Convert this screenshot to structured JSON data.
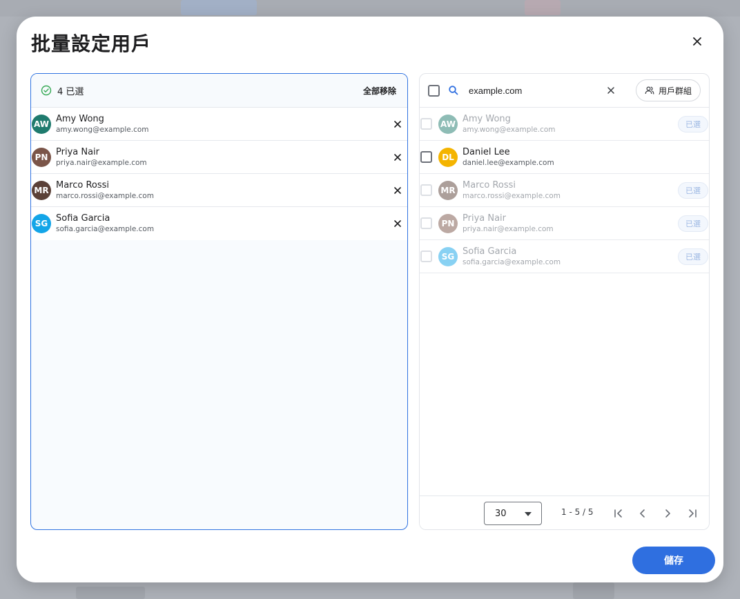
{
  "dialog": {
    "title": "批量設定用戶",
    "save_label": "儲存"
  },
  "selected_panel": {
    "count_label": "4 已選",
    "remove_all_label": "全部移除",
    "users": [
      {
        "initials": "AW",
        "name": "Amy Wong",
        "email": "amy.wong@example.com",
        "color": "#1f7b6e"
      },
      {
        "initials": "PN",
        "name": "Priya Nair",
        "email": "priya.nair@example.com",
        "color": "#7b5549"
      },
      {
        "initials": "MR",
        "name": "Marco Rossi",
        "email": "marco.rossi@example.com",
        "color": "#5b4138"
      },
      {
        "initials": "SG",
        "name": "Sofia Garcia",
        "email": "sofia.garcia@example.com",
        "color": "#13a5e8"
      }
    ]
  },
  "search_panel": {
    "search_value": "example.com",
    "group_button_label": "用戶群組",
    "selected_chip_label": "已選",
    "results": [
      {
        "initials": "AW",
        "name": "Amy Wong",
        "email": "amy.wong@example.com",
        "color": "#1f7b6e",
        "already_selected": true
      },
      {
        "initials": "DL",
        "name": "Daniel Lee",
        "email": "daniel.lee@example.com",
        "color": "#f4b400",
        "already_selected": false
      },
      {
        "initials": "MR",
        "name": "Marco Rossi",
        "email": "marco.rossi@example.com",
        "color": "#5b4138",
        "already_selected": true
      },
      {
        "initials": "PN",
        "name": "Priya Nair",
        "email": "priya.nair@example.com",
        "color": "#7b5549",
        "already_selected": true
      },
      {
        "initials": "SG",
        "name": "Sofia Garcia",
        "email": "sofia.garcia@example.com",
        "color": "#13a5e8",
        "already_selected": true
      }
    ],
    "pagination": {
      "page_size": "30",
      "range_label": "1 - 5 / 5"
    }
  },
  "colors": {
    "accent": "#2f6fe0",
    "check_green": "#34a853"
  }
}
